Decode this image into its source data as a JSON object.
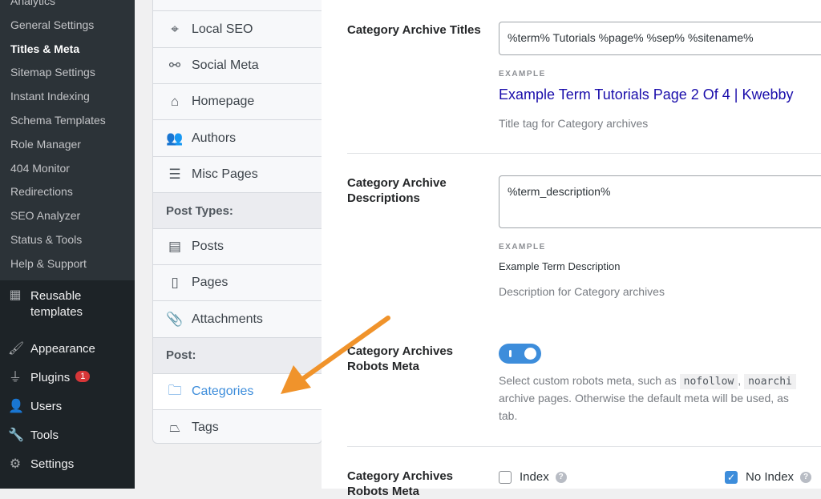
{
  "submenu": [
    "Analytics",
    "General Settings",
    "Titles & Meta",
    "Sitemap Settings",
    "Instant Indexing",
    "Schema Templates",
    "Role Manager",
    "404 Monitor",
    "Redirections",
    "SEO Analyzer",
    "Status & Tools",
    "Help & Support"
  ],
  "menu": [
    {
      "label": "Reusable templates",
      "icon": "grid-icon"
    },
    {
      "label": "Appearance",
      "icon": "paintbrush-icon"
    },
    {
      "label": "Plugins",
      "icon": "plugin-icon",
      "badge": "1"
    },
    {
      "label": "Users",
      "icon": "user-icon"
    },
    {
      "label": "Tools",
      "icon": "wrench-icon"
    },
    {
      "label": "Settings",
      "icon": "settings-icon"
    }
  ],
  "panel": [
    {
      "label": "Local SEO",
      "icon": "map-pin-icon"
    },
    {
      "label": "Social Meta",
      "icon": "share-icon"
    },
    {
      "label": "Homepage",
      "icon": "home-icon"
    },
    {
      "label": "Authors",
      "icon": "users-icon"
    },
    {
      "label": "Misc Pages",
      "icon": "list-icon"
    },
    {
      "label": "Post Types:",
      "header": true
    },
    {
      "label": "Posts",
      "icon": "post-icon"
    },
    {
      "label": "Pages",
      "icon": "page-icon"
    },
    {
      "label": "Attachments",
      "icon": "paperclip-icon"
    },
    {
      "label": "Post:",
      "header": true
    },
    {
      "label": "Categories",
      "icon": "folder-icon",
      "selected": true
    },
    {
      "label": "Tags",
      "icon": "tag-icon"
    }
  ],
  "main": {
    "title_label": "Category Archive Titles",
    "title_value": "%term% Tutorials %page% %sep% %sitename%",
    "example": "EXAMPLE",
    "title_example": "Example Term Tutorials Page 2 Of 4 | Kwebby",
    "title_help": "Title tag for Category archives",
    "desc_label": "Category Archive Descriptions",
    "desc_value": "%term_description%",
    "desc_example": "Example Term Description",
    "desc_help": "Description for Category archives",
    "robots_label": "Category Archives Robots Meta",
    "robots_toggle": true,
    "robots_help_1": "Select custom robots meta, such as",
    "code1": "nofollow",
    "code2": "noarchi",
    "robots_help_2": "archive pages. Otherwise the default meta will be used, as",
    "robots_help_3": "tab.",
    "robots2_label": "Category Archives Robots Meta",
    "index_label": "Index",
    "index_checked": false,
    "noindex_label": "No Index",
    "noindex_checked": true
  },
  "colors": {
    "accent": "#3d8ddb",
    "arrow": "#f0932b",
    "link": "#1a0dab"
  }
}
